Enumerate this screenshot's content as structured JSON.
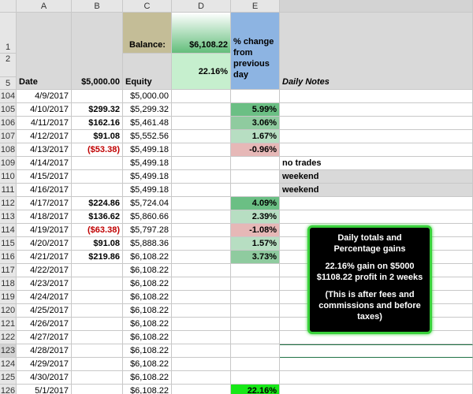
{
  "columns": [
    "A",
    "B",
    "C",
    "D",
    "E"
  ],
  "header": {
    "row_nums": [
      "1",
      "2",
      "5"
    ],
    "balance_label": "Balance:",
    "balance_value": "$6,108.22",
    "pct_header": "% change from previous day",
    "date_label": "Date",
    "start_amount": "$5,000.00",
    "equity_label": "Equity",
    "total_pct": "22.16%",
    "notes_label": "Daily Notes"
  },
  "rows": [
    {
      "n": "104",
      "date": "4/9/2017",
      "pl": "",
      "equity": "$5,000.00",
      "pct": "",
      "note": ""
    },
    {
      "n": "105",
      "date": "4/10/2017",
      "pl": "$299.32",
      "equity": "$5,299.32",
      "pct": "5.99%",
      "note": ""
    },
    {
      "n": "106",
      "date": "4/11/2017",
      "pl": "$162.16",
      "equity": "$5,461.48",
      "pct": "3.06%",
      "note": ""
    },
    {
      "n": "107",
      "date": "4/12/2017",
      "pl": "$91.08",
      "equity": "$5,552.56",
      "pct": "1.67%",
      "note": ""
    },
    {
      "n": "108",
      "date": "4/13/2017",
      "pl": "($53.38)",
      "equity": "$5,499.18",
      "pct": "-0.96%",
      "note": ""
    },
    {
      "n": "109",
      "date": "4/14/2017",
      "pl": "",
      "equity": "$5,499.18",
      "pct": "",
      "note": "no trades"
    },
    {
      "n": "110",
      "date": "4/15/2017",
      "pl": "",
      "equity": "$5,499.18",
      "pct": "",
      "note": "weekend"
    },
    {
      "n": "111",
      "date": "4/16/2017",
      "pl": "",
      "equity": "$5,499.18",
      "pct": "",
      "note": "weekend"
    },
    {
      "n": "112",
      "date": "4/17/2017",
      "pl": "$224.86",
      "equity": "$5,724.04",
      "pct": "4.09%",
      "note": ""
    },
    {
      "n": "113",
      "date": "4/18/2017",
      "pl": "$136.62",
      "equity": "$5,860.66",
      "pct": "2.39%",
      "note": ""
    },
    {
      "n": "114",
      "date": "4/19/2017",
      "pl": "($63.38)",
      "equity": "$5,797.28",
      "pct": "-1.08%",
      "note": ""
    },
    {
      "n": "115",
      "date": "4/20/2017",
      "pl": "$91.08",
      "equity": "$5,888.36",
      "pct": "1.57%",
      "note": ""
    },
    {
      "n": "116",
      "date": "4/21/2017",
      "pl": "$219.86",
      "equity": "$6,108.22",
      "pct": "3.73%",
      "note": ""
    },
    {
      "n": "117",
      "date": "4/22/2017",
      "pl": "",
      "equity": "$6,108.22",
      "pct": "",
      "note": ""
    },
    {
      "n": "118",
      "date": "4/23/2017",
      "pl": "",
      "equity": "$6,108.22",
      "pct": "",
      "note": ""
    },
    {
      "n": "119",
      "date": "4/24/2017",
      "pl": "",
      "equity": "$6,108.22",
      "pct": "",
      "note": ""
    },
    {
      "n": "120",
      "date": "4/25/2017",
      "pl": "",
      "equity": "$6,108.22",
      "pct": "",
      "note": ""
    },
    {
      "n": "121",
      "date": "4/26/2017",
      "pl": "",
      "equity": "$6,108.22",
      "pct": "",
      "note": ""
    },
    {
      "n": "122",
      "date": "4/27/2017",
      "pl": "",
      "equity": "$6,108.22",
      "pct": "",
      "note": ""
    },
    {
      "n": "123",
      "date": "4/28/2017",
      "pl": "",
      "equity": "$6,108.22",
      "pct": "",
      "note": ""
    },
    {
      "n": "124",
      "date": "4/29/2017",
      "pl": "",
      "equity": "$6,108.22",
      "pct": "",
      "note": ""
    },
    {
      "n": "125",
      "date": "4/30/2017",
      "pl": "",
      "equity": "$6,108.22",
      "pct": "",
      "note": ""
    },
    {
      "n": "126",
      "date": "5/1/2017",
      "pl": "",
      "equity": "$6,108.22",
      "pct": "22.16%",
      "note": ""
    }
  ],
  "callout": {
    "line1": "Daily totals and",
    "line2": "Percentage gains",
    "line3": "22.16% gain on $5000",
    "line4": "$1108.22 profit in 2 weeks",
    "line5": "(This is after fees and",
    "line6": "commissions and before",
    "line7": "taxes)"
  },
  "colors": {
    "positive_pct": "#8fcb9f",
    "negative_pct": "#e6b8b7",
    "highlight": "#17e817",
    "callout_border": "#39d13b"
  }
}
